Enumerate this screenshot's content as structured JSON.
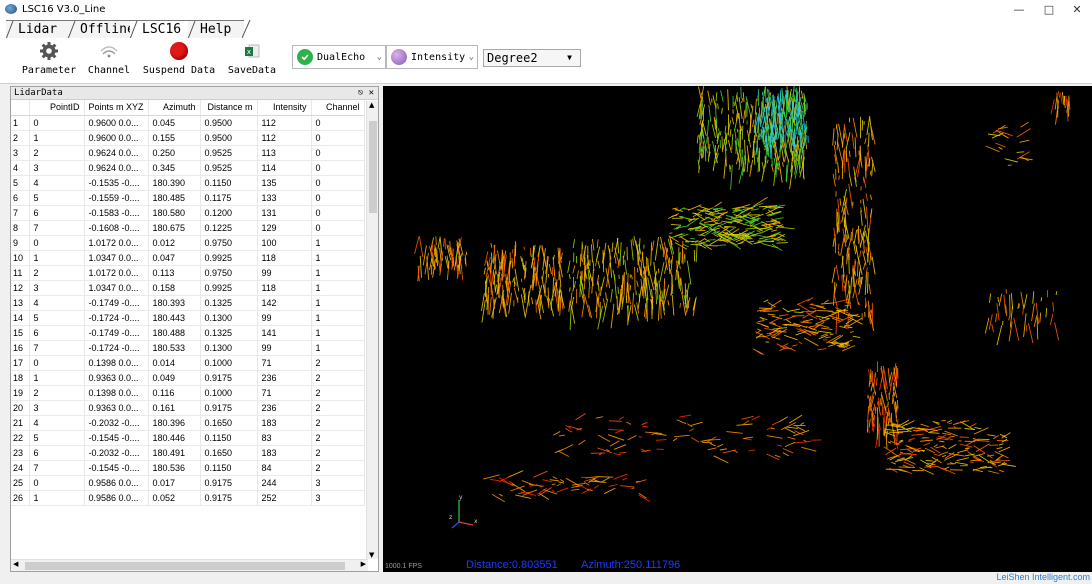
{
  "window": {
    "title": "LSC16 V3.0_Line",
    "minimize": "—",
    "maximize": "□",
    "close": "✕"
  },
  "tabs": [
    {
      "label": "Lidar"
    },
    {
      "label": "Offline"
    },
    {
      "label": "LSC16"
    },
    {
      "label": "Help"
    }
  ],
  "toolbar": {
    "parameter": "Parameter",
    "channel": "Channel",
    "suspend": "Suspend Data",
    "save": "SaveData",
    "dual_echo": "DualEcho",
    "intensity": "Intensity",
    "degree": "Degree2",
    "colors": {
      "suspend_red": "#e01818",
      "dual_green": "#2eb14a",
      "intensity_purple": "#a776c9"
    }
  },
  "panel": {
    "title": "LidarData",
    "columns": [
      "PointID",
      "Points m XYZ",
      "Azimuth",
      "Distance m",
      "Intensity",
      "Channel"
    ],
    "rows": [
      [
        "1",
        "0",
        "0.9600 0.0...",
        "0.045",
        "0.9500",
        "112",
        "0"
      ],
      [
        "2",
        "1",
        "0.9600 0.0...",
        "0.155",
        "0.9500",
        "112",
        "0"
      ],
      [
        "3",
        "2",
        "0.9624 0.0...",
        "0.250",
        "0.9525",
        "113",
        "0"
      ],
      [
        "4",
        "3",
        "0.9624 0.0...",
        "0.345",
        "0.9525",
        "114",
        "0"
      ],
      [
        "5",
        "4",
        "-0.1535 -0....",
        "180.390",
        "0.1150",
        "135",
        "0"
      ],
      [
        "6",
        "5",
        "-0.1559 -0....",
        "180.485",
        "0.1175",
        "133",
        "0"
      ],
      [
        "7",
        "6",
        "-0.1583 -0....",
        "180.580",
        "0.1200",
        "131",
        "0"
      ],
      [
        "8",
        "7",
        "-0.1608 -0....",
        "180.675",
        "0.1225",
        "129",
        "0"
      ],
      [
        "9",
        "0",
        "1.0172 0.0...",
        "0.012",
        "0.9750",
        "100",
        "1"
      ],
      [
        "10",
        "1",
        "1.0347 0.0...",
        "0.047",
        "0.9925",
        "118",
        "1"
      ],
      [
        "11",
        "2",
        "1.0172 0.0...",
        "0.113",
        "0.9750",
        "99",
        "1"
      ],
      [
        "12",
        "3",
        "1.0347 0.0...",
        "0.158",
        "0.9925",
        "118",
        "1"
      ],
      [
        "13",
        "4",
        "-0.1749 -0....",
        "180.393",
        "0.1325",
        "142",
        "1"
      ],
      [
        "14",
        "5",
        "-0.1724 -0....",
        "180.443",
        "0.1300",
        "99",
        "1"
      ],
      [
        "15",
        "6",
        "-0.1749 -0....",
        "180.488",
        "0.1325",
        "141",
        "1"
      ],
      [
        "16",
        "7",
        "-0.1724 -0....",
        "180.533",
        "0.1300",
        "99",
        "1"
      ],
      [
        "17",
        "0",
        "0.1398 0.0...",
        "0.014",
        "0.1000",
        "71",
        "2"
      ],
      [
        "18",
        "1",
        "0.9363 0.0...",
        "0.049",
        "0.9175",
        "236",
        "2"
      ],
      [
        "19",
        "2",
        "0.1398 0.0...",
        "0.116",
        "0.1000",
        "71",
        "2"
      ],
      [
        "20",
        "3",
        "0.9363 0.0...",
        "0.161",
        "0.9175",
        "236",
        "2"
      ],
      [
        "21",
        "4",
        "-0.2032 -0....",
        "180.396",
        "0.1650",
        "183",
        "2"
      ],
      [
        "22",
        "5",
        "-0.1545 -0....",
        "180.446",
        "0.1150",
        "83",
        "2"
      ],
      [
        "23",
        "6",
        "-0.2032 -0....",
        "180.491",
        "0.1650",
        "183",
        "2"
      ],
      [
        "24",
        "7",
        "-0.1545 -0....",
        "180.536",
        "0.1150",
        "84",
        "2"
      ],
      [
        "25",
        "0",
        "0.9586 0.0...",
        "0.017",
        "0.9175",
        "244",
        "3"
      ],
      [
        "26",
        "1",
        "0.9586 0.0...",
        "0.052",
        "0.9175",
        "252",
        "3"
      ]
    ]
  },
  "viewer": {
    "fps": "1000.1 FPS",
    "distance_readout": "Distance:0.803551",
    "azimuth_readout": "Azimuth:250.111796",
    "axis_labels": {
      "x": "x",
      "y": "y",
      "z": "z"
    }
  },
  "status": {
    "brand": "LeiShen Intelligent.com"
  }
}
